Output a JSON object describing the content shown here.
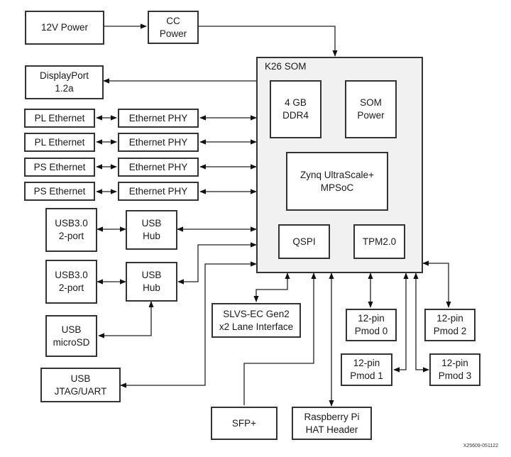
{
  "diagram": {
    "som": {
      "title": "K26 SOM"
    },
    "som_blocks": {
      "ddr": "4 GB\nDDR4",
      "som_power": "SOM\nPower",
      "mpsoc": "Zynq UltraScale+\nMPSoC",
      "qspi": "QSPI",
      "tpm": "TPM2.0"
    },
    "blocks": {
      "power12v": "12V Power",
      "cc_power": "CC\nPower",
      "displayport": "DisplayPort\n1.2a",
      "pl_eth_1": "PL Ethernet",
      "pl_eth_2": "PL Ethernet",
      "ps_eth_1": "PS Ethernet",
      "ps_eth_2": "PS Ethernet",
      "phy_1": "Ethernet PHY",
      "phy_2": "Ethernet PHY",
      "phy_3": "Ethernet PHY",
      "phy_4": "Ethernet PHY",
      "usb30_1": "USB3.0\n2-port",
      "usb30_2": "USB3.0\n2-port",
      "usb_hub_1": "USB\nHub",
      "usb_hub_2": "USB\nHub",
      "usb_microsd": "USB\nmicroSD",
      "usb_jtag": "USB\nJTAG/UART",
      "slvs": "SLVS-EC Gen2\nx2 Lane Interface",
      "sfp": "SFP+",
      "rpi": "Raspberry Pi\nHAT Header",
      "pmod0": "12-pin\nPmod 0",
      "pmod1": "12-pin\nPmod 1",
      "pmod2": "12-pin\nPmod 2",
      "pmod3": "12-pin\nPmod 3"
    },
    "figure_id": "X25609-051122"
  }
}
